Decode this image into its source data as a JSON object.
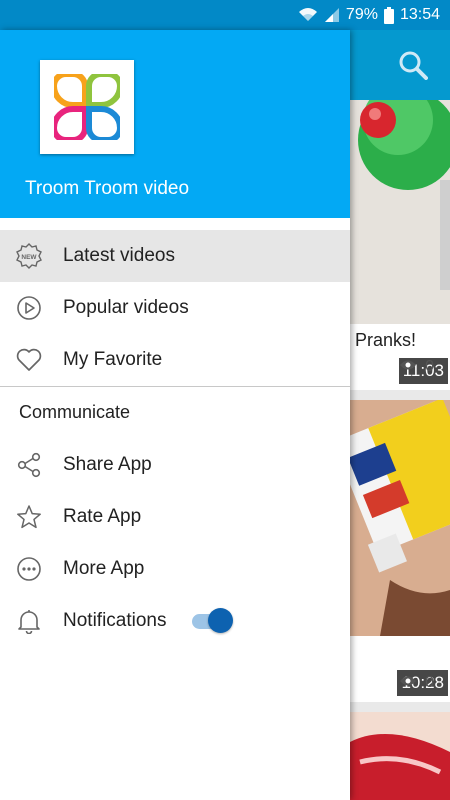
{
  "status_bar": {
    "battery_percent": "79%",
    "time": "13:54",
    "icons": [
      "wifi-icon",
      "cellular-signal-icon",
      "battery-icon"
    ]
  },
  "drawer": {
    "app_name": "Troom Troom video",
    "header_color": "#03a9f4",
    "menu_items": [
      {
        "label": "Latest videos",
        "icon": "new-badge-icon",
        "selected": true
      },
      {
        "label": "Popular videos",
        "icon": "play-circle-icon",
        "selected": false
      },
      {
        "label": "My Favorite",
        "icon": "heart-icon",
        "selected": false
      }
    ],
    "section_title": "Communicate",
    "communicate_items": [
      {
        "label": "Share App",
        "icon": "share-icon"
      },
      {
        "label": "Rate App",
        "icon": "star-icon"
      },
      {
        "label": "More App",
        "icon": "more-dots-icon"
      },
      {
        "label": "Notifications",
        "icon": "bell-icon",
        "toggle_on": true
      }
    ]
  },
  "background_feed": {
    "toolbar_icon": "search-icon",
    "cards": [
      {
        "duration": "11:03",
        "title": "Pranks!",
        "views": "0"
      },
      {
        "duration": "10:28",
        "title": "",
        "views": "0"
      }
    ]
  }
}
